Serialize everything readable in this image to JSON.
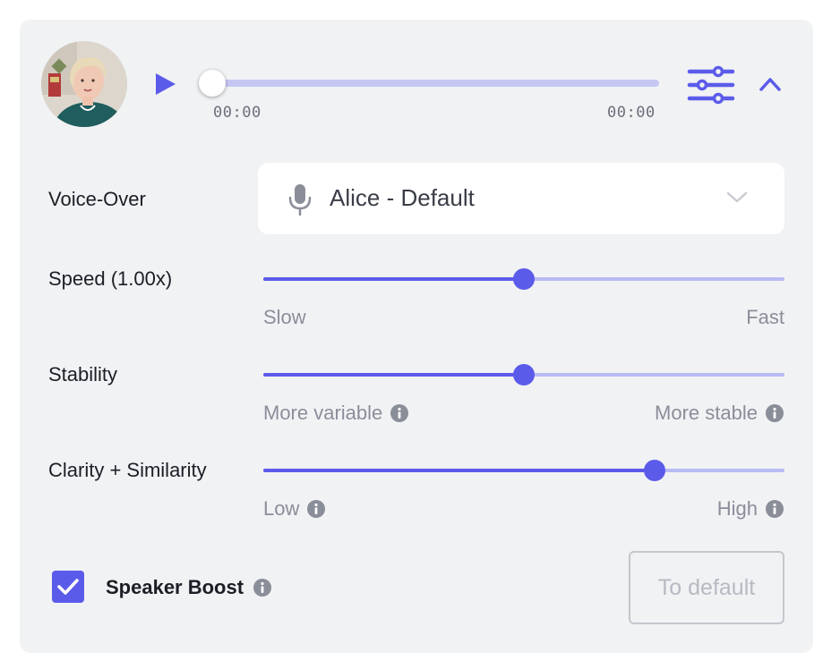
{
  "player": {
    "current_time": "00:00",
    "total_time": "00:00",
    "progress": 0,
    "icons": {
      "play": "play-icon",
      "settings": "sliders-icon",
      "collapse": "chevron-up-icon"
    }
  },
  "voice_over": {
    "label": "Voice-Over",
    "selected": "Alice - Default",
    "icon": "microphone-icon"
  },
  "speed": {
    "label": "Speed (1.00x)",
    "value": 0.5,
    "min_label": "Slow",
    "max_label": "Fast"
  },
  "stability": {
    "label": "Stability",
    "value": 0.5,
    "min_label": "More variable",
    "max_label": "More stable"
  },
  "clarity": {
    "label": "Clarity + Similarity",
    "value": 0.75,
    "min_label": "Low",
    "max_label": "High"
  },
  "speaker_boost": {
    "label": "Speaker Boost",
    "checked": true
  },
  "reset_button": {
    "label": "To default"
  },
  "colors": {
    "accent": "#5b5bea",
    "accent_light": "#b9bbf4",
    "panel_bg": "#f1f2f4",
    "muted_text": "#8a8e99"
  }
}
